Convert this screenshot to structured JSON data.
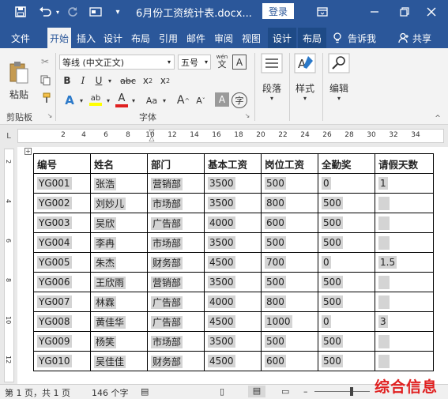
{
  "titlebar": {
    "title": "6月份工资统计表.docx...",
    "login": "登录",
    "icons": [
      "save-icon",
      "undo-icon",
      "redo-icon",
      "customize-icon",
      "ribbon-display-icon",
      "minimize-icon",
      "restore-icon",
      "close-icon"
    ],
    "color": "#2b579a"
  },
  "tabs": [
    "文件",
    "开始",
    "插入",
    "设计",
    "布局",
    "引用",
    "邮件",
    "审阅",
    "视图",
    "设计",
    "布局"
  ],
  "active_tab": "开始",
  "tell_me": "告诉我",
  "share": "共享",
  "ribbon": {
    "paste": "粘贴",
    "clipboard_group": "剪贴板",
    "font_name": "等线 (中文正文)",
    "font_size": "五号",
    "wen": "wén",
    "font_group": "字体",
    "paragraph": "段落",
    "styles": "样式",
    "editing": "编辑"
  },
  "ruler": {
    "marker": "L",
    "numbers": [
      "2",
      "4",
      "6",
      "8",
      "10",
      "12",
      "14",
      "16",
      "18",
      "20",
      "22",
      "24",
      "26",
      "28",
      "30",
      "32",
      "34"
    ]
  },
  "vruler": {
    "numbers": [
      "2",
      "4",
      "6",
      "8",
      "10",
      "12"
    ]
  },
  "table": {
    "headers": [
      "编号",
      "姓名",
      "部门",
      "基本工资",
      "岗位工资",
      "全勤奖",
      "请假天数"
    ],
    "rows": [
      [
        "YG001",
        "张浩",
        "营销部",
        "3500",
        "500",
        "0",
        "1"
      ],
      [
        "YG002",
        "刘妙儿",
        "市场部",
        "3500",
        "800",
        "500",
        ""
      ],
      [
        "YG003",
        "吴欣",
        "广告部",
        "4000",
        "600",
        "500",
        ""
      ],
      [
        "YG004",
        "李冉",
        "市场部",
        "3500",
        "500",
        "500",
        ""
      ],
      [
        "YG005",
        "朱杰",
        "财务部",
        "4500",
        "700",
        "0",
        "1.5"
      ],
      [
        "YG006",
        "王欣雨",
        "营销部",
        "3500",
        "500",
        "500",
        ""
      ],
      [
        "YG007",
        "林霖",
        "广告部",
        "4000",
        "800",
        "500",
        ""
      ],
      [
        "YG008",
        "黄佳华",
        "广告部",
        "4500",
        "1000",
        "0",
        "3"
      ],
      [
        "YG009",
        "杨笑",
        "市场部",
        "3500",
        "500",
        "500",
        ""
      ],
      [
        "YG010",
        "吴佳佳",
        "财务部",
        "4500",
        "600",
        "500",
        ""
      ]
    ]
  },
  "status": {
    "page": "第 1 页，共 1 页",
    "words": "146 个字"
  },
  "watermark": "综合信息"
}
